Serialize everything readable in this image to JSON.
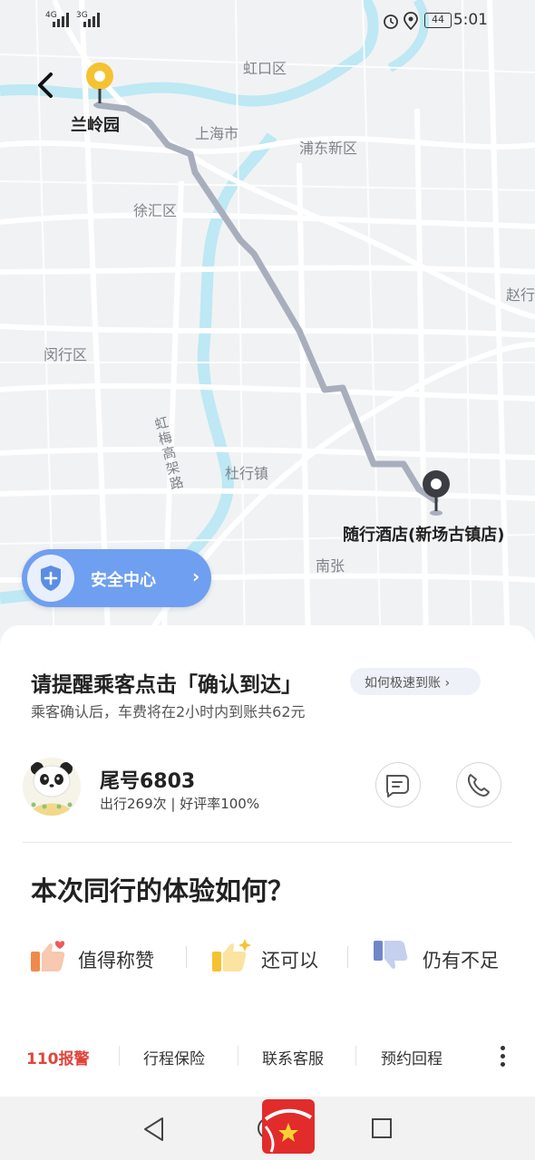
{
  "status_bar": {
    "signal_1": "4G",
    "signal_2": "3G",
    "battery": "44",
    "time": "5:01"
  },
  "map": {
    "districts": [
      "虹口区",
      "上海市",
      "浦东新区",
      "徐汇区",
      "赵行",
      "闵行区",
      "杜行镇",
      "南张"
    ],
    "road_label": "虹梅高架路",
    "start_label": "兰岭园",
    "end_label": "随行酒店(新场古镇店)",
    "colors": {
      "route": "#a9aebd",
      "water": "#bde8f4",
      "start_pin": "#f5c231",
      "end_pin": "#3b3d42"
    }
  },
  "safety_center": {
    "label": "安全中心"
  },
  "reminder": {
    "title": "请提醒乘客点击「确认到达」",
    "help_link": "如何极速到账",
    "subtitle": "乘客确认后，车费将在2小时内到账共62元"
  },
  "passenger": {
    "name": "尾号6803",
    "stats": "出行269次 | 好评率100%"
  },
  "rating": {
    "question": "本次同行的体验如何？",
    "options": [
      {
        "label": "值得称赞"
      },
      {
        "label": "还可以"
      },
      {
        "label": "仍有不足"
      }
    ]
  },
  "bottom_bar": {
    "police": "110报警",
    "insurance": "行程保险",
    "service": "联系客服",
    "return_trip": "预约回程"
  }
}
